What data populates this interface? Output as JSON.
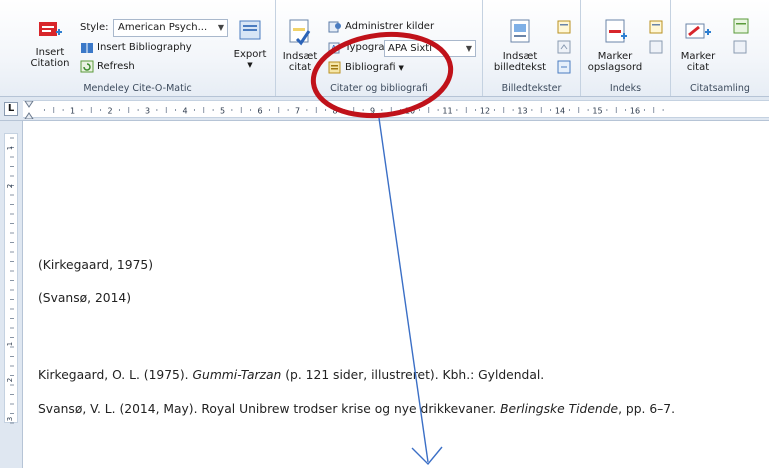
{
  "mendeley": {
    "insert_citation": "Insert\nCitation",
    "style_label": "Style:",
    "style_value": "American Psych...",
    "insert_bibliography": "Insert Bibliography",
    "refresh": "Refresh",
    "export": "Export",
    "group_label": "Mendeley Cite-O-Matic"
  },
  "citater": {
    "indsaet_citat": "Indsæt\ncitat",
    "administrer_kilder": "Administrer kilder",
    "typografi_label": "Typografi:",
    "typografi_value": "APA Sixtl",
    "bibliografi": "Bibliografi",
    "group_label": "Citater og bibliografi"
  },
  "billedtekster": {
    "indsaet_billedtekst": "Indsæt\nbilledtekst",
    "group_label": "Billedtekster"
  },
  "indeks": {
    "marker_opslagsord": "Marker\nopslagsord",
    "group_label": "Indeks"
  },
  "citatsamling": {
    "marker_citat": "Marker\ncitat",
    "group_label": "Citatsamling"
  },
  "ruler": {
    "corner": "L",
    "numbers": [
      "1",
      "2",
      "3",
      "4",
      "5",
      "6",
      "7",
      "8",
      "9",
      "10",
      "11",
      "12",
      "13",
      "14",
      "15",
      "16"
    ],
    "vnumbers": [
      "1",
      "2",
      "1",
      "2",
      "3",
      "4"
    ]
  },
  "document": {
    "citation_1": "(Kirkegaard, 1975)",
    "citation_2": "(Svansø, 2014)",
    "bib_1": {
      "before": "Kirkegaard, O. L. (1975). ",
      "title": "Gummi-Tarzan",
      "after": " (p. 121 sider, illustreret). Kbh.: Gyldendal."
    },
    "bib_2": {
      "before": "Svansø, V. L. (2014, May). Royal Unibrew trodser krise og nye drikkevaner. ",
      "title": "Berlingske Tidende",
      "after": ", pp. 6–7."
    }
  },
  "colors": {
    "ribbon_bg": "#eef2f8",
    "annotation_red": "#c0121a",
    "annotation_blue": "#3b6fc6",
    "text": "#222222"
  }
}
